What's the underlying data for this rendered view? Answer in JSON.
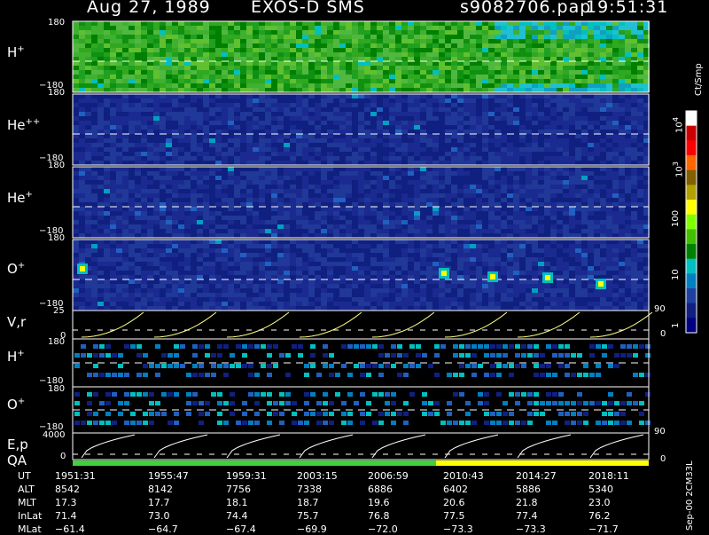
{
  "header": {
    "date": "Aug 27, 1989",
    "instrument": "EXOS-D SMS",
    "file": "s9082706.pap",
    "time": "19:51:31"
  },
  "panels": {
    "hplus": {
      "species": "H",
      "charge": "+",
      "ytop": "180",
      "ybot": "−180"
    },
    "hepp": {
      "species": "He",
      "charge": "++",
      "ytop": "180",
      "ybot": "−180"
    },
    "heplus": {
      "species": "He",
      "charge": "+",
      "ytop": "180",
      "ybot": "−180"
    },
    "oplus": {
      "species": "O",
      "charge": "+",
      "ytop": "180",
      "ybot": "−180"
    },
    "vr": {
      "label": "V,r",
      "ytop": "25",
      "ybot": "0",
      "right_top": "90",
      "right_bot": "0"
    },
    "hplus2": {
      "species": "H",
      "charge": "+",
      "ytop": "180",
      "ybot": "−180"
    },
    "oplus2": {
      "species": "O",
      "charge": "+",
      "ytop": "180",
      "ybot": "−180"
    },
    "ep": {
      "label": "E,p",
      "ytop": "4000",
      "ybot": "0",
      "right_top": "90",
      "right_bot": "0"
    },
    "qa": {
      "label": "QA"
    }
  },
  "colorbar": {
    "unit": "Ct/Smp",
    "ticks": [
      "10",
      "10",
      "100",
      "10",
      "1"
    ],
    "tick_exps": [
      "4",
      "3",
      "",
      "",
      ""
    ],
    "colors": [
      "#ffffff",
      "#cc0000",
      "#ff0000",
      "#ff6600",
      "#806000",
      "#b0a000",
      "#ffff00",
      "#80ff00",
      "#40c000",
      "#008000",
      "#00c0c0",
      "#0080c0",
      "#2040a0",
      "#102080",
      "#000080"
    ]
  },
  "footer_note": "Sep-00 2CM33L",
  "chart_data": {
    "type": "heatmap",
    "title": "Aug 27, 1989   EXOS-D SMS",
    "xlabel": "UT",
    "x_rows": {
      "UT": [
        "1951:31",
        "1955:47",
        "1959:31",
        "2003:15",
        "2006:59",
        "2010:43",
        "2014:27",
        "2018:11"
      ],
      "ALT": [
        "8542",
        "8142",
        "7756",
        "7338",
        "6886",
        "6402",
        "5886",
        "5340"
      ],
      "MLT": [
        "17.3",
        "17.7",
        "18.1",
        "18.7",
        "19.6",
        "20.6",
        "21.8",
        "23.0"
      ],
      "InLat": [
        "71.4",
        "73.0",
        "74.4",
        "75.7",
        "76.8",
        "77.5",
        "77.4",
        "76.2"
      ],
      "MLat": [
        "−61.4",
        "−64.7",
        "−67.4",
        "−69.9",
        "−72.0",
        "−73.3",
        "−73.3",
        "−71.7"
      ]
    },
    "series": [
      {
        "name": "H+",
        "ylim": [
          -180,
          180
        ]
      },
      {
        "name": "He++",
        "ylim": [
          -180,
          180
        ]
      },
      {
        "name": "He+",
        "ylim": [
          -180,
          180
        ]
      },
      {
        "name": "O+",
        "ylim": [
          -180,
          180
        ]
      },
      {
        "name": "V,r",
        "ylim": [
          0,
          25
        ]
      },
      {
        "name": "H+",
        "ylim": [
          -180,
          180
        ]
      },
      {
        "name": "O+",
        "ylim": [
          -180,
          180
        ]
      },
      {
        "name": "E,p",
        "ylim": [
          0,
          4000
        ]
      }
    ],
    "qa": [
      {
        "from": "1951:31",
        "to": "2010:43",
        "color": "#40d040"
      },
      {
        "from": "2010:43",
        "to": "2021:00",
        "color": "#ffff00"
      }
    ],
    "colorbar_label": "Ct/Smp"
  }
}
